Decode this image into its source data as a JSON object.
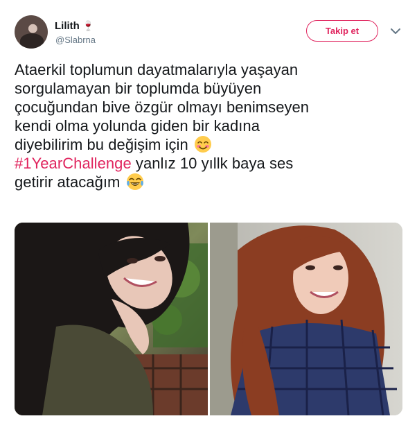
{
  "tweet": {
    "author": {
      "display_name": "Lilith",
      "name_emoji": "wine-glass-icon",
      "handle": "@Slabrna"
    },
    "follow_label": "Takip et",
    "text_lines": [
      "Ataerkil toplumun dayatmalarıyla yaşayan",
      "sorgulamayan bir toplumda büyüyen",
      "çocuğundan bive özgür olmayı benimseyen",
      "kendi olma yolunda giden bir kadına",
      "diyebilirim bu değişim için"
    ],
    "hashtag": "#1YearChallenge",
    "text_after_hashtag": "yanlız 10 yıllk baya ses",
    "text_last": "getirir atacağım",
    "emojis": [
      "smiling-blush-emoji",
      "tears-of-joy-emoji"
    ],
    "media": [
      {
        "label": "photo-left"
      },
      {
        "label": "photo-right"
      }
    ]
  },
  "colors": {
    "accent": "#e0245e",
    "text": "#14171a",
    "secondary": "#657786"
  }
}
